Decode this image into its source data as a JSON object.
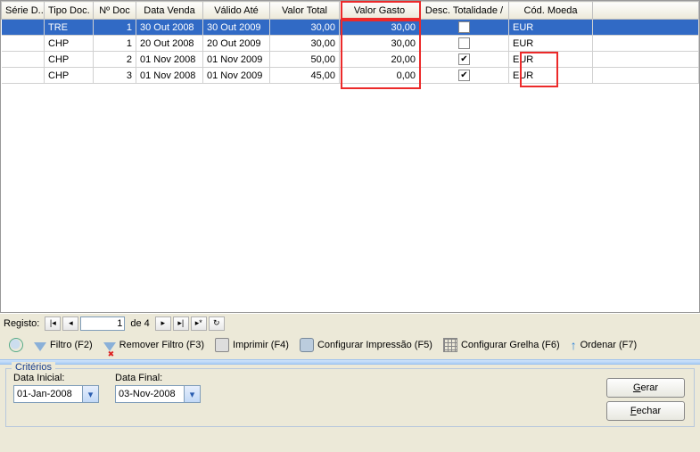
{
  "columns": {
    "serie": "Série D...",
    "tipo": "Tipo Doc.",
    "num": "Nº Doc",
    "dataVenda": "Data Venda",
    "validoAte": "Válido Até",
    "valorTotal": "Valor Total",
    "valorGasto": "Valor Gasto",
    "descTotal": "Desc. Totalidade /",
    "codMoeda": "Cód. Moeda"
  },
  "rows": [
    {
      "serie": "",
      "tipo": "TRE",
      "num": "1",
      "dataVenda": "30 Out 2008",
      "validoAte": "30 Out 2009",
      "valorTotal": "30,00",
      "valorGasto": "30,00",
      "desc": false,
      "moeda": "EUR",
      "selected": true
    },
    {
      "serie": "",
      "tipo": "CHP",
      "num": "1",
      "dataVenda": "20 Out 2008",
      "validoAte": "20 Out 2009",
      "valorTotal": "30,00",
      "valorGasto": "30,00",
      "desc": false,
      "moeda": "EUR",
      "selected": false
    },
    {
      "serie": "",
      "tipo": "CHP",
      "num": "2",
      "dataVenda": "01 Nov 2008",
      "validoAte": "01 Nov 2009",
      "valorTotal": "50,00",
      "valorGasto": "20,00",
      "desc": true,
      "moeda": "EUR",
      "selected": false
    },
    {
      "serie": "",
      "tipo": "CHP",
      "num": "3",
      "dataVenda": "01 Nov 2008",
      "validoAte": "01 Nov 2009",
      "valorTotal": "45,00",
      "valorGasto": "0,00",
      "desc": true,
      "moeda": "EUR",
      "selected": false
    }
  ],
  "nav": {
    "label": "Registo:",
    "current": "1",
    "totalPrefix": "de",
    "total": "4"
  },
  "toolbar": {
    "filtro": "Filtro (F2)",
    "removerFiltro": "Remover Filtro (F3)",
    "imprimir": "Imprimir (F4)",
    "configImp": "Configurar Impressão (F5)",
    "configGrelha": "Configurar Grelha (F6)",
    "ordenar": "Ordenar (F7)"
  },
  "criteria": {
    "title": "Critérios",
    "dataInicialLabel": "Data Inicial:",
    "dataInicial": "01-Jan-2008",
    "dataFinalLabel": "Data Final:",
    "dataFinal": "03-Nov-2008"
  },
  "buttons": {
    "gerar": "Gerar",
    "fechar": "Fechar"
  }
}
